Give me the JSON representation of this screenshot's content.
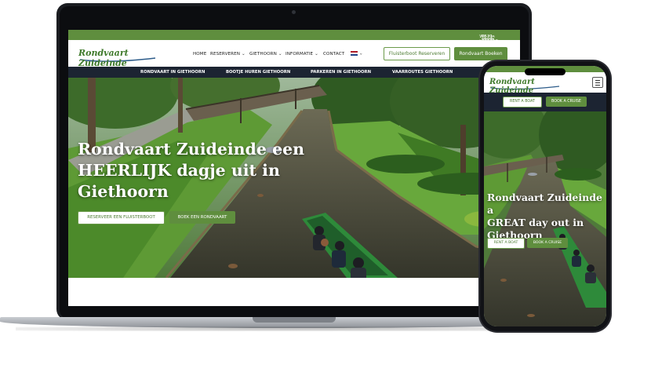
{
  "desktop": {
    "topbar": {
      "text": "Wij zijn te bereiken van 10:00 - 15:00 op",
      "phone": "0521-361718"
    },
    "logo": "Rondvaart Zuideinde",
    "nav": [
      "HOME",
      "RESERVEREN",
      "GIETHOORN",
      "INFORMATIE",
      "CONTACT"
    ],
    "nav_dropdown_mark": "⌄",
    "lang_flag": "NL",
    "cta_outline": "Fluisterboot Reserveren",
    "cta_solid": "Rondvaart Boeken",
    "subnav": [
      "RONDVAART IN GIETHOORN",
      "BOOTJE HUREN GIETHOORN",
      "PARKEREN IN GIETHOORN",
      "VAARROUTES GIETHOORN"
    ],
    "hero": {
      "title_lines": [
        "Rondvaart Zuideinde een",
        "HEERLIJK dagje uit in",
        "Giethoorn"
      ],
      "button_outline": "RESERVEER EEN FLUISTERBOOT",
      "button_solid": "BOEK EEN RONDVAART"
    }
  },
  "mobile": {
    "logo": "Rondvaart Zuideinde",
    "menu_icon": "hamburger-icon",
    "cta_outline": "RENT A BOAT",
    "cta_solid": "BOOK A CRUISE",
    "hero": {
      "title_lines": [
        "Rondvaart Zuideinde a",
        "GREAT day out in",
        "Giethoorn"
      ],
      "button_outline": "RENT A BOAT",
      "button_solid": "BOOK A CRUISE"
    }
  },
  "colors": {
    "brand_green": "#5f8e3e",
    "navy": "#1c2432",
    "canal": "#4a4a3a",
    "grass": "#5e9a35"
  }
}
